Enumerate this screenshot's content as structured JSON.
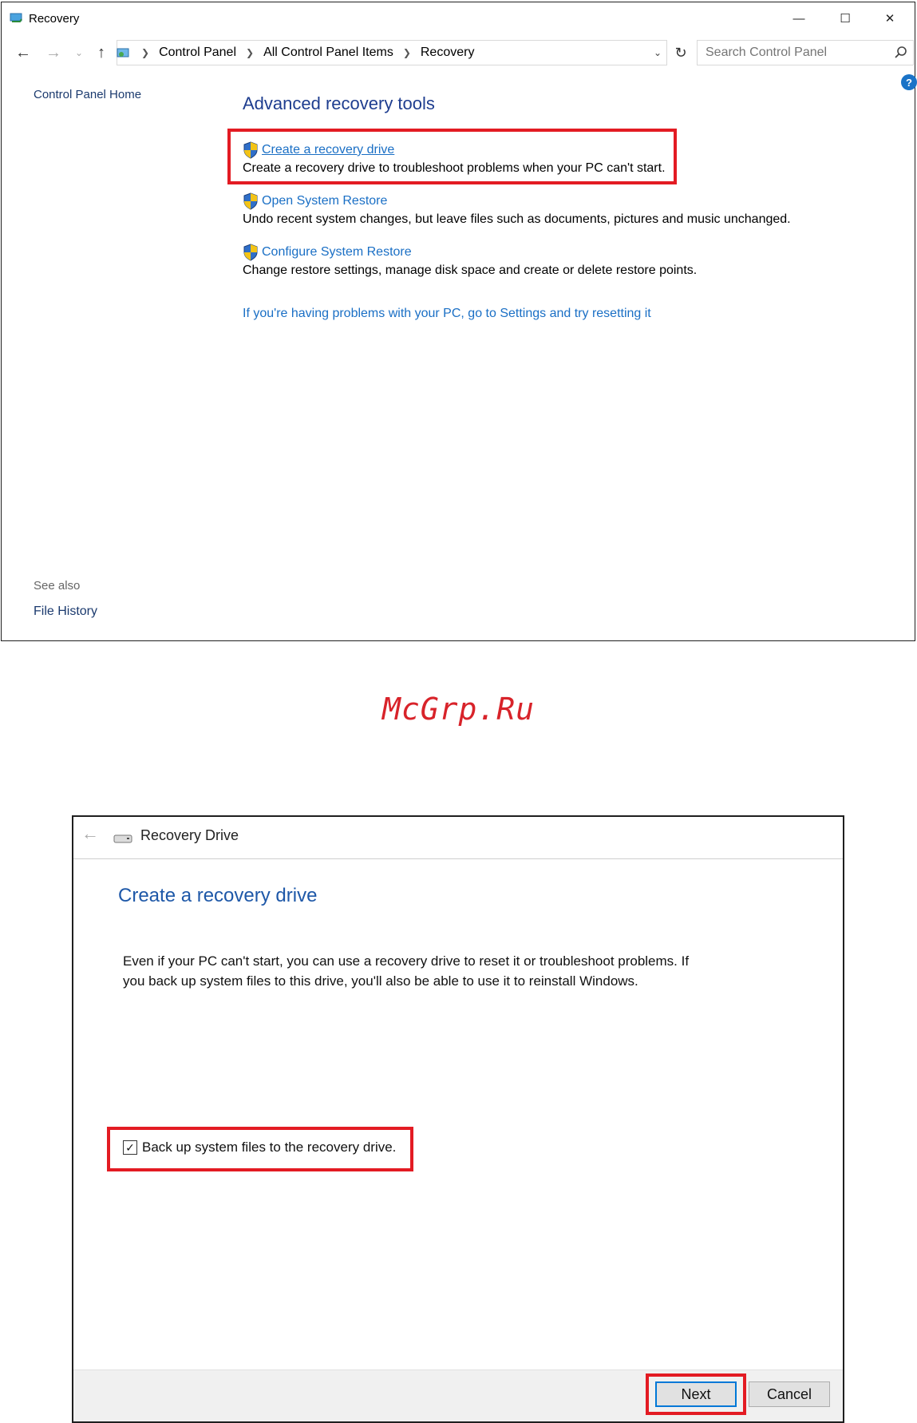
{
  "window1": {
    "title": "Recovery",
    "controls": {
      "minimize": "—",
      "maximize": "☐",
      "close": "✕"
    },
    "breadcrumbs": [
      "Control Panel",
      "All Control Panel Items",
      "Recovery"
    ],
    "search_placeholder": "Search Control Panel",
    "sidebar": {
      "home_link": "Control Panel Home",
      "see_also_label": "See also",
      "file_history_link": "File History"
    },
    "help_label": "?",
    "section_title": "Advanced recovery tools",
    "tasks": [
      {
        "label": "Create a recovery drive",
        "description": "Create a recovery drive to troubleshoot problems when your PC can't start."
      },
      {
        "label": "Open System Restore",
        "description": "Undo recent system changes, but leave files such as documents, pictures and music unchanged."
      },
      {
        "label": "Configure System Restore",
        "description": "Change restore settings, manage disk space and create or delete restore points."
      }
    ],
    "reset_link": "If you're having problems with your PC, go to Settings and try resetting it"
  },
  "watermark": "McGrp.Ru",
  "window2": {
    "title": "Recovery Drive",
    "heading": "Create a recovery drive",
    "body_line1": "Even if your PC can't start, you can use a recovery drive to reset it or troubleshoot problems. If",
    "body_line2": "you back up system files to this drive, you'll also be able to use it to reinstall Windows.",
    "checkbox_label": "Back up system files to the recovery drive.",
    "checkbox_checked": true,
    "buttons": {
      "next": "Next",
      "cancel": "Cancel"
    }
  },
  "colors": {
    "highlight": "#e31b23",
    "link": "#1a6fc5",
    "heading": "#1e3d8f",
    "accent": "#0078d7"
  }
}
